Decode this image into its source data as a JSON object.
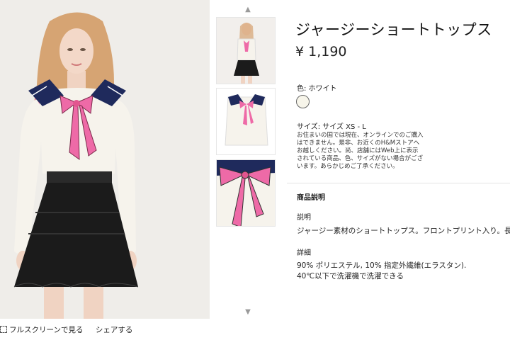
{
  "product": {
    "title": "ジャージーショートトップス",
    "price": "¥ 1,190",
    "color_label": "色: ホワイト",
    "size_label": "サイズ: サイズ XS - L",
    "availability_notice": "お住まいの国では現在、オンラインでのご購入はできません。是非、お近くのH&Mストアへお越しください。尚、店舗にはWeb上に表示されている商品、色、サイズがない場合がございます。あらかじめご了承ください。"
  },
  "details_section": {
    "heading": "商品説明",
    "description_heading": "説明",
    "description_text": "ジャージー素材のショートトップス。フロントプリント入り。長袖",
    "details_heading": "詳細",
    "details_lines": [
      "90% ポリエステル, 10% 指定外繊維(エラスタン).",
      "40℃以下で洗濯機で洗濯できる"
    ]
  },
  "footer": {
    "fullscreen_label": "フルスクリーンで見る",
    "share_label": "シェアする"
  },
  "thumbnails": {
    "up_arrow": "▲",
    "down_arrow": "▼"
  },
  "colors": {
    "skin": "#f3d8c8",
    "hair": "#d9a878",
    "hair_pink": "#e87aa0",
    "top": "#f6f3ec",
    "bow": "#ee6aa7",
    "collar": "#1f2a5c",
    "skirt": "#1a1a1a",
    "swatch": "#f7f5ea"
  }
}
